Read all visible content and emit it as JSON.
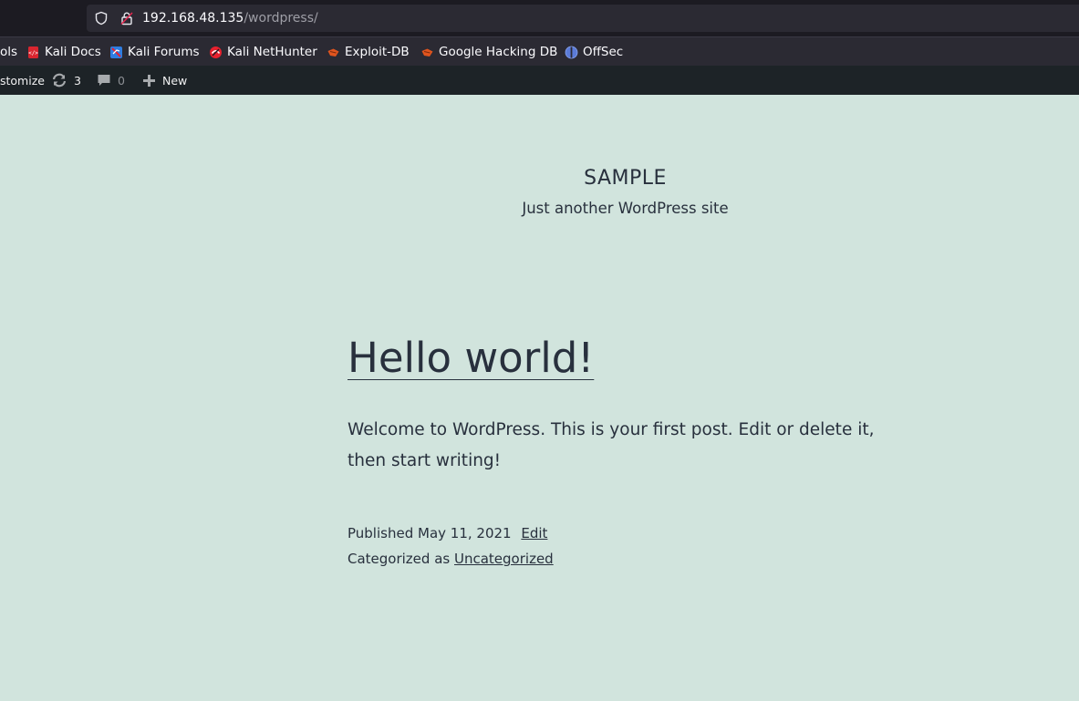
{
  "browser": {
    "url_host": "192.168.48.135",
    "url_path": "/wordpress/",
    "bookmarks": [
      {
        "label": "ols",
        "icon": "folder-icon"
      },
      {
        "label": "Kali Docs",
        "icon": "kali-docs-icon",
        "color": "#e8212e"
      },
      {
        "label": "Kali Forums",
        "icon": "kali-forums-icon",
        "color": "#2f7de1"
      },
      {
        "label": "Kali NetHunter",
        "icon": "kali-nethunter-icon",
        "color": "#e8212e"
      },
      {
        "label": "Exploit-DB",
        "icon": "exploit-db-icon",
        "color": "#e0541e"
      },
      {
        "label": "Google Hacking DB",
        "icon": "ghdb-icon",
        "color": "#e0541e"
      },
      {
        "label": "OffSec",
        "icon": "offsec-icon",
        "color": "#5b7bd8"
      }
    ]
  },
  "adminbar": {
    "customize_label": "stomize",
    "updates_count": "3",
    "comments_count": "0",
    "new_label": "New"
  },
  "site": {
    "title": "SAMPLE",
    "description": "Just another WordPress site"
  },
  "post": {
    "title": "Hello world!",
    "body": "Welcome to WordPress. This is your first post. Edit or delete it, then start writing!",
    "published_prefix": "Published",
    "date": "May 11, 2021",
    "edit_label": "Edit",
    "categorized_prefix": "Categorized as",
    "category": "Uncategorized"
  },
  "colors": {
    "page_bg": "#d1e4dd",
    "text": "#28303d",
    "adminbar_bg": "#1d2327",
    "browser_bg": "#1c1b22"
  }
}
